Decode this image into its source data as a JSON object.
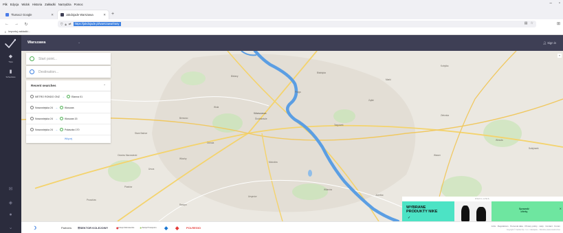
{
  "browser": {
    "menu": [
      "Plik",
      "Edycja",
      "Widok",
      "Historia",
      "Zakładki",
      "Narzędzia",
      "Pomoc"
    ],
    "tabs": [
      {
        "title": "Tłumacz Google",
        "active": false,
        "favicon_color": "#4a7be8"
      },
      {
        "title": "Jakdojade Warszawa",
        "active": true,
        "favicon_color": "#3e3f55"
      }
    ],
    "url": "https://jakdojade.pl/warszawa/trasy",
    "bookmarks_item": "Importuj zakładki..."
  },
  "app": {
    "city": "Warszawa",
    "signin": "Sign in",
    "sidebar": [
      {
        "label": "Trips",
        "icon": "route-icon"
      },
      {
        "label": "Schedules",
        "icon": "schedule-icon"
      }
    ],
    "start_placeholder": "Start point...",
    "destination_placeholder": "Destination..."
  },
  "recent": {
    "title": "Recent searches",
    "items": [
      {
        "from": "METRO RONDO ONZ",
        "to": "Ełanna 01"
      },
      {
        "from": "Nowowiejska 24",
        "to": "Kłosowa"
      },
      {
        "from": "Nowowiejska 24",
        "to": "Kłosowa 15"
      },
      {
        "from": "Nowowiejska 24",
        "to": "Połaszka 170"
      }
    ],
    "more": "Więcej"
  },
  "map": {
    "labels": [
      "Warszawa",
      "Praga",
      "Śródmieście",
      "Wola",
      "Targówek",
      "Ochota",
      "Mokotów",
      "Wawer",
      "Ursus",
      "Włochy",
      "Bemowo",
      "Białołęka",
      "Bielany",
      "Wilanów",
      "Ursynów",
      "Wesoła",
      "Sulejówek",
      "Kobyłka",
      "Zielonka",
      "Ożarów Mazowiecki",
      "Piastów",
      "Pruszków",
      "Raszyn",
      "Józefów",
      "Marki",
      "Ząbki",
      "Stare Babice"
    ]
  },
  "ad": {
    "label": "REKLAMA",
    "headline_1": "WYBRANE",
    "headline_2": "PRODUKTY NIKE",
    "cta_1": "Sprawdź",
    "cta_2": "ofertę"
  },
  "footer": {
    "partners": "Partners",
    "logos": [
      "SEKTOR KOLEJOWY",
      "Koleje Mazowieckie",
      "Zarząd Transportu",
      "Tramwaje",
      "POLREGIO"
    ],
    "links": "Jobs · Regulations · Personal data · Privacy policy · Help · Contact · Forum",
    "copyright": "Copyright © CityNav Sp. z o.o. i Jakdojade – Wszelkie prawa zastrzeżone"
  },
  "colors": {
    "sidebar": "#2b2c3d",
    "topbar": "#3e3f55",
    "river": "#5b9ee3",
    "accent": "#3d80e0"
  }
}
